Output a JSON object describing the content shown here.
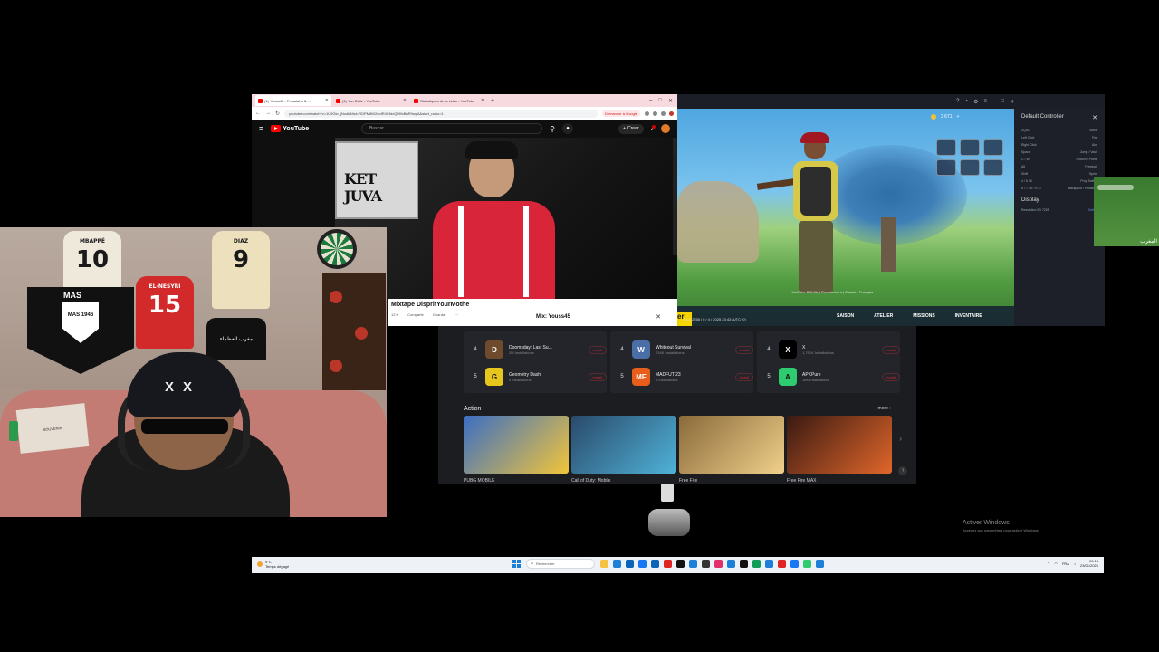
{
  "chrome": {
    "tabs": [
      {
        "label": "(1) Youss45 - Prosalaho & ...",
        "active": true
      },
      {
        "label": "(1) Yan Dellz - YouTube",
        "active": false
      },
      {
        "label": "Statistiques de la vidéo - YouTube",
        "active": false
      }
    ],
    "new_tab": "+",
    "window_controls": [
      "–",
      "□",
      "✕"
    ],
    "url": "youtube.com/watch?v=1U9Gkr_jNodk&list=RDPM8W2mdR4CfdxQM9xBuR9wpA&start_radio=1",
    "translate_label": "Demander à Google"
  },
  "youtube": {
    "logo": "YouTube",
    "search_placeholder": "Buscar",
    "create_label": "Crear",
    "poster_text": "KET JUVA",
    "video_title": "Mixtape DispritYourMothe",
    "actions": [
      "12 K",
      "Compartir",
      "Guardar",
      "···"
    ],
    "mix_label": "Mix: Youss45",
    "close_label": "✕"
  },
  "game": {
    "hud_currency": "3 671",
    "nav": [
      "SAISON",
      "ATELIER",
      "MISSIONS",
      "INVENTAIRE"
    ],
    "lobby_tag": "YouTube BAKAL | Recrutement | Classé - Français",
    "version": "4.2.0.2258 | 0 / 4 / 2025 23:43 (UTC+0)",
    "yellow_tag": "er",
    "control_panel": {
      "title": "Default Controller",
      "rows": [
        {
          "key": "ZQSD",
          "value": "Move"
        },
        {
          "key": "Left Click",
          "value": "Fire"
        },
        {
          "key": "Right Click",
          "value": "Aim"
        },
        {
          "key": "Space",
          "value": "Jump / Vault"
        },
        {
          "key": "C / W",
          "value": "Crouch / Prone"
        },
        {
          "key": "Alt",
          "value": "Freelook"
        },
        {
          "key": "Shift",
          "value": "Sprint"
        },
        {
          "key": "4 / 5 / 6",
          "value": "Prop Switch"
        },
        {
          "key": "6 / 7 / 8 / 9 / 0",
          "value": "Backpack / Positions"
        }
      ],
      "display_title": "Display",
      "resolution_label": "Resolution 5D 720P",
      "resolution_action": "Switch",
      "close": "✕"
    }
  },
  "sliver_text": "المغرب",
  "store": {
    "columns": [
      {
        "apps": [
          {
            "rank": "4",
            "name": "Doomsday: Last Su...",
            "installs": "2M Installations",
            "btn": "Install",
            "color": "#6d4b2c",
            "glyph": "D"
          },
          {
            "rank": "5",
            "name": "Geometry Dash",
            "installs": "5 Installations",
            "btn": "Install",
            "color": "#e6c51c",
            "glyph": "G"
          }
        ]
      },
      {
        "apps": [
          {
            "rank": "4",
            "name": "Whiteout Survival",
            "installs": "234K Installations",
            "btn": "Install",
            "color": "#4a6fa6",
            "glyph": "W"
          },
          {
            "rank": "5",
            "name": "MADFUT 23",
            "installs": "8 Installations",
            "btn": "Install",
            "color": "#e85d1a",
            "glyph": "MF"
          }
        ]
      },
      {
        "apps": [
          {
            "rank": "4",
            "name": "X",
            "installs": "1,791K Installations",
            "btn": "Install",
            "color": "#000000",
            "glyph": "X"
          },
          {
            "rank": "5",
            "name": "APKPure",
            "installs": "18K Installations",
            "btn": "Install",
            "color": "#2ecc71",
            "glyph": "A"
          }
        ]
      }
    ],
    "section_title": "Action",
    "more": "more ›",
    "cards": [
      {
        "caption": "PUBG MOBILE",
        "color1": "#3a6ec4",
        "color2": "#f2c53a"
      },
      {
        "caption": "Call of Duty: Mobile",
        "color1": "#2a4a6a",
        "color2": "#4fb2d8"
      },
      {
        "caption": "Free Fire",
        "color1": "#8a6a3a",
        "color2": "#f0d08a"
      },
      {
        "caption": "Free Fire MAX",
        "color1": "#3a1a12",
        "color2": "#e0662a"
      }
    ]
  },
  "webcam": {
    "jerseys": [
      {
        "name": "MBAPPÉ",
        "number": "10",
        "bg": "#efe9dc",
        "fg": "#1a1a1a"
      },
      {
        "name": "EL-NESYRI",
        "number": "15",
        "bg": "#d22a2a",
        "fg": "#ffffff"
      },
      {
        "name": "DIAZ",
        "number": "9",
        "bg": "#ede0bd",
        "fg": "#1a1a1a"
      }
    ],
    "flag_text": "MAS",
    "shield_text": "MAS 1946",
    "shirt_text": "مغرب العظماء",
    "photo_text": "SOUVENIR"
  },
  "activate_windows": {
    "line1": "Activer Windows",
    "line2": "Accédez aux paramètres pour activer Windows."
  },
  "taskbar": {
    "temp": "9°C",
    "weather": "Temps dégagé",
    "search_placeholder": "Rechercher",
    "pinned": [
      "#f5c242",
      "#1e7fd8",
      "#0a64b8",
      "#1877f2",
      "#0a64b8",
      "#e02424",
      "#111111",
      "#1e7fd8",
      "#333333",
      "#e1306c",
      "#1e7fd8",
      "#111111",
      "#0f9d58",
      "#1e7fd8",
      "#e02424",
      "#1877f2",
      "#2ecc71",
      "#1e7fd8"
    ],
    "lang": "FRA",
    "time": "00:13",
    "date": "23/01/2026"
  }
}
